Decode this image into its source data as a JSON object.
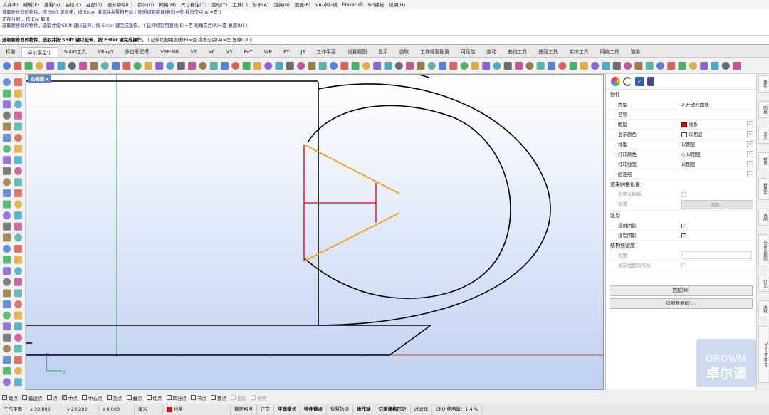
{
  "menu": [
    "文件(F)",
    "编辑(E)",
    "查看(V)",
    "曲线(C)",
    "曲面(S)",
    "细分物件(U)",
    "实体(O)",
    "网格(M)",
    "尺寸标注(D)",
    "变动(T)",
    "工具(L)",
    "分析(A)",
    "渲染(R)",
    "面板(P)",
    "VR-卓尔谟",
    "Maverick",
    "BG螺栓",
    "说明(H)"
  ],
  "command_history": [
    "选取要修剪的物件，按 Shift 键延伸，按 Enter 键清除并重新开始 ( 延伸切割用直线(E)=否  视角交点(A)=是 )",
    "正在分割... 按 Esc 取消",
    "选取要修剪的物件，选取并按 Shift 键以延伸，按 Enter 键完成操作。 ( 延伸切割用直线(E)=否  视角交点(A)=是  复原(U) )"
  ],
  "command_prompt": "选取要修剪的物件，选取并按 Shift 键以延伸，按 Enter 键完成操作。",
  "command_options": " ( 延伸切割用直线(E)=否  视角交点(A)=是  复原(U) ):",
  "tabs": [
    "标准",
    "卓尔谟星牛",
    "SubD工具",
    "VRay5",
    "多边形建模",
    "VSR-MR",
    "V7",
    "V6",
    "V5",
    "PeT",
    "WB",
    "PT",
    "JS",
    "工作平面",
    "设置视图",
    "显示",
    "选取",
    "工作视窗配置",
    "可见性",
    "变动",
    "曲线工具",
    "曲面工具",
    "实体工具",
    "网格工具",
    "渲染"
  ],
  "active_tab": "卓尔谟星牛",
  "viewport": {
    "label": "右视图"
  },
  "colors": {
    "layer_red": "#e00000",
    "orange": "#f5a000",
    "red_line": "#e8262c",
    "grid_green": "#3aa03a"
  },
  "properties": {
    "section_object": "物件",
    "rows": [
      {
        "k": "类型",
        "v": "2 开放的曲线"
      },
      {
        "k": "名称",
        "v": ""
      },
      {
        "k": "图层",
        "v": "线条"
      },
      {
        "k": "显示颜色",
        "v": "以图层"
      },
      {
        "k": "线型",
        "v": "以图层"
      },
      {
        "k": "打印颜色",
        "v": "以图层"
      },
      {
        "k": "打印线宽",
        "v": "以图层"
      },
      {
        "k": "超连结",
        "v": ""
      }
    ],
    "section_render_mesh": "渲染网格设置",
    "custom_mesh": "自定义网格",
    "settings": "设置",
    "adjust": "调整...",
    "section_render": "渲染",
    "cast_shadows": "投射阴影",
    "receive_shadows": "接受阴影",
    "section_isocurve": "结构线密度",
    "density": "密度",
    "show_surface_iso": "显示曲面结构线",
    "match_btn": "匹配(M)",
    "details_btn": "详细数据(D)..."
  },
  "right_tabs": [
    "属性",
    "图层",
    "显示",
    "材质",
    "材质库",
    "说明",
    "已命名视图",
    "灯光",
    "选取",
    "Grasshopper"
  ],
  "osnaps": [
    {
      "label": "端点",
      "on": true
    },
    {
      "label": "最近点",
      "on": false
    },
    {
      "label": "点",
      "on": false
    },
    {
      "label": "中点",
      "on": true
    },
    {
      "label": "中心点",
      "on": false
    },
    {
      "label": "交点",
      "on": false
    },
    {
      "label": "垂点",
      "on": false
    },
    {
      "label": "切点",
      "on": false
    },
    {
      "label": "四分点",
      "on": false
    },
    {
      "label": "节点",
      "on": false
    },
    {
      "label": "顶点",
      "on": false
    },
    {
      "label": "投影",
      "on": false,
      "dis": true
    },
    {
      "label": "停用",
      "on": false,
      "dis": true
    }
  ],
  "status": {
    "cplane": "工作平面",
    "x": "x 33.896",
    "y": "y 23.202",
    "z": "z 0.000",
    "unit": "毫米",
    "layer": "线条",
    "items": [
      "锁定格点",
      "正交",
      "平面模式",
      "物件锁点",
      "智慧轨迹",
      "操作轴",
      "记录建构历史",
      "过滤器"
    ],
    "bold": [
      "平面模式",
      "物件锁点",
      "操作轴",
      "记录建构历史"
    ],
    "cpu": "CPU 使用量：1.4 %"
  },
  "watermark": {
    "line1": "DROWM",
    "line2": "卓尔谟"
  }
}
